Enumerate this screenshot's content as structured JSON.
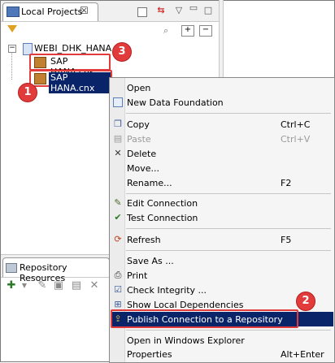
{
  "local_projects": {
    "tab_label": "Local Projects",
    "tree": {
      "root_label": "WEBI_DHK_HANA",
      "expander": "−",
      "items": [
        {
          "label": "SAP HANA.cns",
          "icon": "connection-shortcut-icon"
        },
        {
          "label": "SAP HANA.cnx",
          "icon": "connection-file-icon"
        }
      ]
    }
  },
  "repository": {
    "tab_label": "Repository Resources"
  },
  "badges": [
    "1",
    "2",
    "3"
  ],
  "context_menu": {
    "items": [
      {
        "label": "Open",
        "shortcut": "",
        "icon": ""
      },
      {
        "label": "New Data Foundation",
        "shortcut": "",
        "icon": "new-data-foundation-icon"
      },
      {
        "label": "Copy",
        "shortcut": "Ctrl+C",
        "icon": "copy-icon"
      },
      {
        "label": "Paste",
        "shortcut": "Ctrl+V",
        "icon": "paste-icon",
        "disabled": true
      },
      {
        "label": "Delete",
        "shortcut": "",
        "icon": "delete-icon"
      },
      {
        "label": "Move...",
        "shortcut": "",
        "icon": ""
      },
      {
        "label": "Rename...",
        "shortcut": "F2",
        "icon": ""
      },
      {
        "label": "Edit Connection",
        "shortcut": "",
        "icon": "edit-connection-icon"
      },
      {
        "label": "Test Connection",
        "shortcut": "",
        "icon": "test-connection-icon"
      },
      {
        "label": "Refresh",
        "shortcut": "F5",
        "icon": "refresh-icon"
      },
      {
        "label": "Save As ...",
        "shortcut": "",
        "icon": ""
      },
      {
        "label": "Print",
        "shortcut": "",
        "icon": "print-icon"
      },
      {
        "label": "Check Integrity ...",
        "shortcut": "",
        "icon": "check-integrity-icon"
      },
      {
        "label": "Show Local Dependencies",
        "shortcut": "",
        "icon": "show-dependencies-icon"
      },
      {
        "label": "Publish Connection to a Repository",
        "shortcut": "",
        "icon": "publish-icon",
        "highlighted": true
      },
      {
        "label": "Open in Windows Explorer",
        "shortcut": "",
        "icon": ""
      },
      {
        "label": "Properties",
        "shortcut": "Alt+Enter",
        "icon": ""
      }
    ]
  },
  "colors": {
    "selection": "#0a246a",
    "annotation_red": "#e23b3b"
  }
}
